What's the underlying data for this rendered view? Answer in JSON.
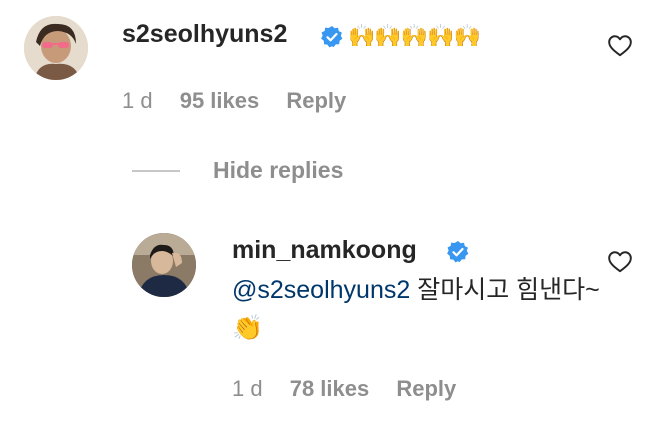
{
  "comment": {
    "username": "s2seolhyuns2",
    "text": "🙌🙌🙌🙌🙌",
    "age": "1 d",
    "likes": "95 likes",
    "reply_label": "Reply"
  },
  "thread": {
    "hide_replies_label": "Hide replies"
  },
  "reply": {
    "username": "min_namkoong",
    "mention": "@s2seolhyuns2",
    "text": " 잘마시고 힘낸다~👏",
    "age": "1 d",
    "likes": "78 likes",
    "reply_label": "Reply"
  },
  "colors": {
    "text": "#262626",
    "meta": "#8e8e8e",
    "mention": "#00376b",
    "verified": "#3897f0"
  },
  "icons": {
    "verified": "verified-badge-icon",
    "like": "heart-icon"
  }
}
